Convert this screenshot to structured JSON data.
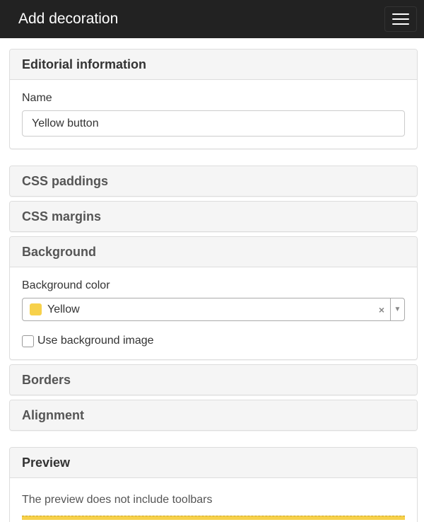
{
  "topbar": {
    "title": "Add decoration",
    "menu_icon": "hamburger-icon"
  },
  "panels": {
    "editorial": {
      "heading": "Editorial information",
      "name_label": "Name",
      "name_value": "Yellow button"
    },
    "paddings": {
      "heading": "CSS paddings"
    },
    "margins": {
      "heading": "CSS margins"
    },
    "background": {
      "heading": "Background",
      "color_label": "Background color",
      "color_value": "Yellow",
      "color_swatch": "#f7d14b",
      "clear_glyph": "×",
      "arrow_glyph": "▼",
      "use_image_label": "Use background image",
      "use_image_checked": false
    },
    "borders": {
      "heading": "Borders"
    },
    "alignment": {
      "heading": "Alignment"
    },
    "preview": {
      "heading": "Preview",
      "note": "The preview does not include toolbars"
    }
  },
  "colors": {
    "topbar": "#222222",
    "panel_heading_bg": "#f5f5f5",
    "accent_yellow": "#f7d14b"
  }
}
